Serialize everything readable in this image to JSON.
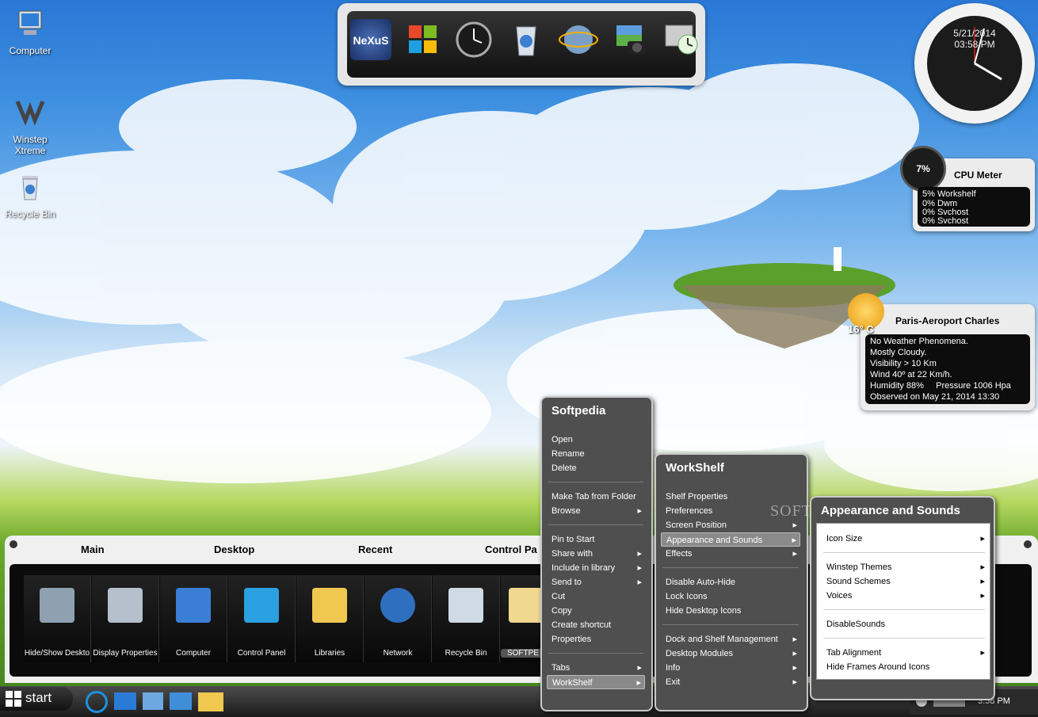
{
  "desktop_icons": [
    {
      "label": "Computer",
      "icon": "computer-icon"
    },
    {
      "label": "Winstep\nXtreme",
      "icon": "winstep-icon"
    },
    {
      "label": "Recycle Bin",
      "icon": "recycle-bin-icon"
    }
  ],
  "dock": {
    "items": [
      "nexus-icon",
      "windows-icon",
      "clock-icon",
      "recycle-bin-icon",
      "globe-icon",
      "camera-icon",
      "monitor-clock-icon"
    ]
  },
  "clock": {
    "date": "5/21/2014",
    "time": "03:58 PM"
  },
  "cpu_meter": {
    "title": "CPU Meter",
    "percent": "7%",
    "lines": [
      "5% Workshelf",
      "0% Dwm",
      "0% Svchost",
      "0% Svchost"
    ]
  },
  "weather": {
    "location": "Paris-Aeroport Charles",
    "temp": "16° C",
    "lines": [
      "No Weather Phenomena.",
      "Mostly Cloudy.",
      "Visibility > 10 Km",
      "Wind 40º at 22 Km/h.",
      "Humidity 88%     Pressure 1006 Hpa",
      "Observed on May 21, 2014 13:30"
    ]
  },
  "shelf": {
    "tabs": [
      "Main",
      "Desktop",
      "Recent",
      "Control Pa"
    ],
    "tiles": [
      {
        "label": "Hide/Show Deskto",
        "icon": "desktop-icon"
      },
      {
        "label": "Display Properties",
        "icon": "display-icon"
      },
      {
        "label": "Computer",
        "icon": "computer-icon"
      },
      {
        "label": "Control Panel",
        "icon": "control-panel-icon"
      },
      {
        "label": "Libraries",
        "icon": "libraries-icon"
      },
      {
        "label": "Network",
        "icon": "network-icon"
      },
      {
        "label": "Recycle Bin",
        "icon": "recycle-bin-icon"
      },
      {
        "label": "SOFTPE",
        "icon": "folder-icon"
      }
    ]
  },
  "taskbar": {
    "start": "start",
    "time": "3:58 PM"
  },
  "menu1": {
    "title": "Softpedia",
    "items": [
      "Open",
      "Rename",
      "Delete",
      "Make Tab from Folder",
      "Browse",
      "Pin to Start",
      "Share with",
      "Include in library",
      "Send to",
      "Cut",
      "Copy",
      "Create shortcut",
      "Properties",
      "Tabs",
      "WorkShelf"
    ]
  },
  "menu2": {
    "title": "WorkShelf",
    "items": [
      "Shelf Properties",
      "Preferences",
      "Screen Position",
      "Appearance and Sounds",
      "Effects",
      "Disable Auto-Hide",
      "Lock Icons",
      "Hide Desktop Icons",
      "Dock and Shelf Management",
      "Desktop Modules",
      "Info",
      "Exit"
    ]
  },
  "menu3": {
    "title": "Appearance and Sounds",
    "items": [
      "Icon Size",
      "Winstep Themes",
      "Sound Schemes",
      "Voices",
      "DisableSounds",
      "Tab Alignment",
      "Hide Frames Around Icons"
    ]
  },
  "watermark": "SOFTPEDIA",
  "colors": {
    "menu_bg": "#4f4f4f",
    "menu_border": "#c9c9c9",
    "highlight": "#8a8a8a",
    "shelf_bg": "#0b0b0b"
  }
}
